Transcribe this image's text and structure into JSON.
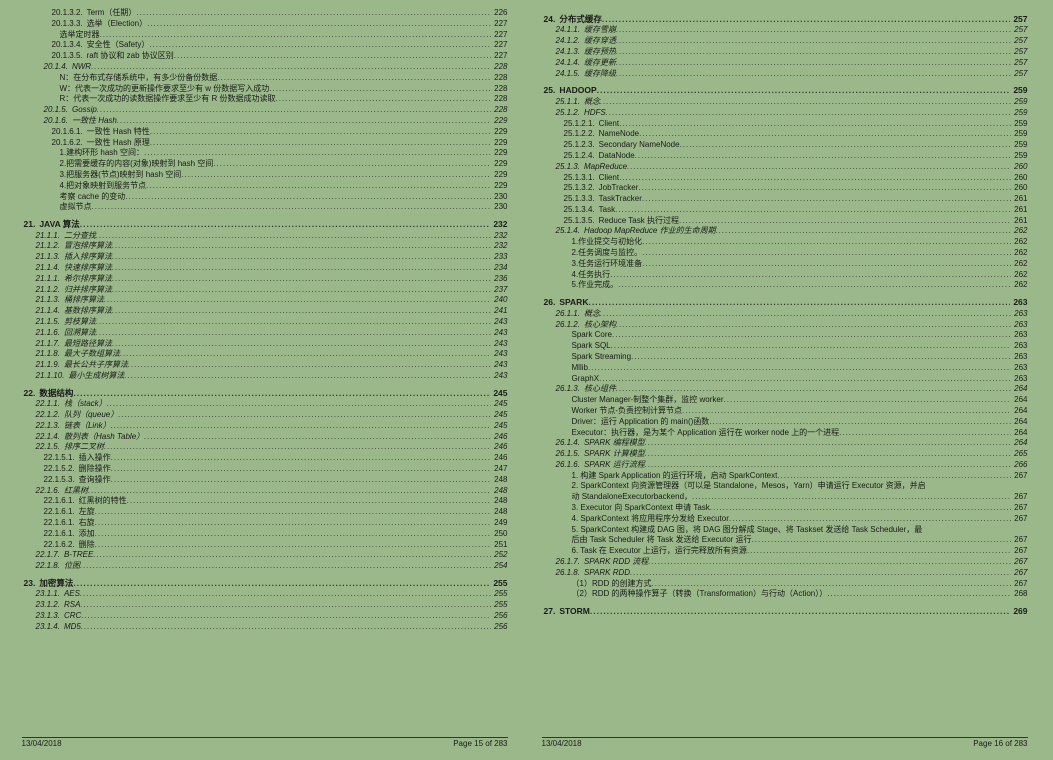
{
  "footer": {
    "date": "13/04/2018",
    "left": "Page 15 of 283",
    "right": "Page 16 of 283"
  },
  "left_page": [
    {
      "cls": "lvl4",
      "num": "20.1.3.2.",
      "title": "Term（任期）",
      "page": "226"
    },
    {
      "cls": "lvl4",
      "num": "20.1.3.3.",
      "title": "选举（Election）",
      "page": "227"
    },
    {
      "cls": "lvl5",
      "num": "",
      "title": "选举定时器",
      "page": "227"
    },
    {
      "cls": "lvl4",
      "num": "20.1.3.4.",
      "title": "安全性（Safety）",
      "page": "227"
    },
    {
      "cls": "lvl4",
      "num": "20.1.3.5.",
      "title": "raft 协议和 zab 协议区别",
      "page": "227"
    },
    {
      "cls": "lvl3i",
      "num": "20.1.4.",
      "title": "NWR",
      "page": "228"
    },
    {
      "cls": "lvl5",
      "num": "",
      "title": "N：在分布式存储系统中，有多少份备份数据",
      "page": "228"
    },
    {
      "cls": "lvl5",
      "num": "",
      "title": "W：代表一次成功的更新操作要求至少有 w 份数据写入成功",
      "page": "228"
    },
    {
      "cls": "lvl5",
      "num": "",
      "title": "R：代表一次成功的读数据操作要求至少有 R 份数据成功读取",
      "page": "228"
    },
    {
      "cls": "lvl3i",
      "num": "20.1.5.",
      "title": "Gossip",
      "page": "228"
    },
    {
      "cls": "lvl3i",
      "num": "20.1.6.",
      "title": "一致性 Hash",
      "page": "229"
    },
    {
      "cls": "lvl4",
      "num": "20.1.6.1.",
      "title": "一致性 Hash 特性",
      "page": "229"
    },
    {
      "cls": "lvl4",
      "num": "20.1.6.2.",
      "title": "一致性 Hash 原理",
      "page": "229"
    },
    {
      "cls": "lvl5",
      "num": "",
      "title": "1.建构环形 hash 空间：",
      "page": "229"
    },
    {
      "cls": "lvl5",
      "num": "",
      "title": "2.把需要缓存的内容(对象)映射到 hash 空间",
      "page": "229"
    },
    {
      "cls": "lvl5",
      "num": "",
      "title": "3.把服务器(节点)映射到 hash 空间",
      "page": "229"
    },
    {
      "cls": "lvl5",
      "num": "",
      "title": "4.把对象映射到服务节点",
      "page": "229"
    },
    {
      "cls": "lvl5",
      "num": "",
      "title": "考察 cache 的变动",
      "page": "230"
    },
    {
      "cls": "lvl5",
      "num": "",
      "title": "虚拟节点",
      "page": "230"
    },
    {
      "cls": "lvl1",
      "num": "21.",
      "title": "JAVA 算法",
      "page": "232"
    },
    {
      "cls": "lvl2i",
      "num": "21.1.1.",
      "title": "二分查找",
      "page": "232"
    },
    {
      "cls": "lvl2i",
      "num": "21.1.2.",
      "title": "冒泡排序算法",
      "page": "232"
    },
    {
      "cls": "lvl2i",
      "num": "21.1.3.",
      "title": "插入排序算法",
      "page": "233"
    },
    {
      "cls": "lvl2i",
      "num": "21.1.4.",
      "title": "快速排序算法",
      "page": "234"
    },
    {
      "cls": "lvl2i",
      "num": "21.1.1.",
      "title": "希尔排序算法",
      "page": "236"
    },
    {
      "cls": "lvl2i",
      "num": "21.1.2.",
      "title": "归并排序算法",
      "page": "237"
    },
    {
      "cls": "lvl2i",
      "num": "21.1.3.",
      "title": "桶排序算法",
      "page": "240"
    },
    {
      "cls": "lvl2i",
      "num": "21.1.4.",
      "title": "基数排序算法",
      "page": "241"
    },
    {
      "cls": "lvl2i",
      "num": "21.1.5.",
      "title": "剪枝算法",
      "page": "243"
    },
    {
      "cls": "lvl2i",
      "num": "21.1.6.",
      "title": "回溯算法",
      "page": "243"
    },
    {
      "cls": "lvl2i",
      "num": "21.1.7.",
      "title": "最短路径算法",
      "page": "243"
    },
    {
      "cls": "lvl2i",
      "num": "21.1.8.",
      "title": "最大子数组算法",
      "page": "243"
    },
    {
      "cls": "lvl2i",
      "num": "21.1.9.",
      "title": "最长公共子序算法",
      "page": "243"
    },
    {
      "cls": "lvl2i",
      "num": "21.1.10.",
      "title": "最小生成树算法",
      "page": "243"
    },
    {
      "cls": "lvl1",
      "num": "22.",
      "title": "数据结构",
      "page": "245"
    },
    {
      "cls": "lvl2i",
      "num": "22.1.1.",
      "title": "栈（stack）",
      "page": "245"
    },
    {
      "cls": "lvl2i",
      "num": "22.1.2.",
      "title": "队列（queue）",
      "page": "245"
    },
    {
      "cls": "lvl2i",
      "num": "22.1.3.",
      "title": "链表（Link）",
      "page": "245"
    },
    {
      "cls": "lvl2i",
      "num": "22.1.4.",
      "title": "散列表（Hash Table）",
      "page": "246"
    },
    {
      "cls": "lvl2i",
      "num": "22.1.5.",
      "title": "排序二叉树",
      "page": "246"
    },
    {
      "cls": "lvl3",
      "num": "22.1.5.1.",
      "title": "插入操作",
      "page": "246"
    },
    {
      "cls": "lvl3",
      "num": "22.1.5.2.",
      "title": "删除操作",
      "page": "247"
    },
    {
      "cls": "lvl3",
      "num": "22.1.5.3.",
      "title": "查询操作",
      "page": "248"
    },
    {
      "cls": "lvl2i",
      "num": "22.1.6.",
      "title": "红黑树",
      "page": "248"
    },
    {
      "cls": "lvl3",
      "num": "22.1.6.1.",
      "title": "红黑树的特性",
      "page": "248"
    },
    {
      "cls": "lvl3",
      "num": "22.1.6.1.",
      "title": "左旋",
      "page": "248"
    },
    {
      "cls": "lvl3",
      "num": "22.1.6.1.",
      "title": "右旋",
      "page": "249"
    },
    {
      "cls": "lvl3",
      "num": "22.1.6.1.",
      "title": "添加",
      "page": "250"
    },
    {
      "cls": "lvl3",
      "num": "22.1.6.2.",
      "title": "删除",
      "page": "251"
    },
    {
      "cls": "lvl2i",
      "num": "22.1.7.",
      "title": "B-TREE",
      "page": "252"
    },
    {
      "cls": "lvl2i",
      "num": "22.1.8.",
      "title": "位图",
      "page": "254"
    },
    {
      "cls": "lvl1",
      "num": "23.",
      "title": "加密算法",
      "page": "255"
    },
    {
      "cls": "lvl2i",
      "num": "23.1.1.",
      "title": "AES",
      "page": "255"
    },
    {
      "cls": "lvl2i",
      "num": "23.1.2.",
      "title": "RSA",
      "page": "255"
    },
    {
      "cls": "lvl2i",
      "num": "23.1.3.",
      "title": "CRC",
      "page": "256"
    },
    {
      "cls": "lvl2i",
      "num": "23.1.4.",
      "title": "MD5",
      "page": "256"
    }
  ],
  "right_page": [
    {
      "cls": "lvl1",
      "num": "24.",
      "title": "分布式缓存",
      "page": "257"
    },
    {
      "cls": "lvl2i",
      "num": "24.1.1.",
      "title": "缓存雪崩",
      "page": "257"
    },
    {
      "cls": "lvl2i",
      "num": "24.1.2.",
      "title": "缓存穿透",
      "page": "257"
    },
    {
      "cls": "lvl2i",
      "num": "24.1.3.",
      "title": "缓存预热",
      "page": "257"
    },
    {
      "cls": "lvl2i",
      "num": "24.1.4.",
      "title": "缓存更新",
      "page": "257"
    },
    {
      "cls": "lvl2i",
      "num": "24.1.5.",
      "title": "缓存降级",
      "page": "257"
    },
    {
      "cls": "lvl1",
      "num": "25.",
      "title": "HADOOP",
      "page": "259"
    },
    {
      "cls": "lvl2i",
      "num": "25.1.1.",
      "title": "概念",
      "page": "259"
    },
    {
      "cls": "lvl2i",
      "num": "25.1.2.",
      "title": "HDFS",
      "page": "259"
    },
    {
      "cls": "lvl3",
      "num": "25.1.2.1.",
      "title": "Client",
      "page": "259"
    },
    {
      "cls": "lvl3",
      "num": "25.1.2.2.",
      "title": "NameNode",
      "page": "259"
    },
    {
      "cls": "lvl3",
      "num": "25.1.2.3.",
      "title": "Secondary NameNode",
      "page": "259"
    },
    {
      "cls": "lvl3",
      "num": "25.1.2.4.",
      "title": "DataNode",
      "page": "259"
    },
    {
      "cls": "lvl2i",
      "num": "25.1.3.",
      "title": "MapReduce",
      "page": "260"
    },
    {
      "cls": "lvl3",
      "num": "25.1.3.1.",
      "title": "Client",
      "page": "260"
    },
    {
      "cls": "lvl3",
      "num": "25.1.3.2.",
      "title": "JobTracker",
      "page": "260"
    },
    {
      "cls": "lvl3",
      "num": "25.1.3.3.",
      "title": "TaskTracker",
      "page": "261"
    },
    {
      "cls": "lvl3",
      "num": "25.1.3.4.",
      "title": "Task",
      "page": "261"
    },
    {
      "cls": "lvl3",
      "num": "25.1.3.5.",
      "title": "Reduce Task 执行过程",
      "page": "261"
    },
    {
      "cls": "lvl2i",
      "num": "25.1.4.",
      "title": "Hadoop MapReduce 作业的生命周期",
      "page": "262"
    },
    {
      "cls": "lvl4",
      "num": "",
      "title": "1.作业提交与初始化",
      "page": "262"
    },
    {
      "cls": "lvl4",
      "num": "",
      "title": "2.任务调度与监控。",
      "page": "262"
    },
    {
      "cls": "lvl4",
      "num": "",
      "title": "3.任务运行环境准备",
      "page": "262"
    },
    {
      "cls": "lvl4",
      "num": "",
      "title": "4.任务执行",
      "page": "262"
    },
    {
      "cls": "lvl4",
      "num": "",
      "title": "5.作业完成。",
      "page": "262"
    },
    {
      "cls": "lvl1",
      "num": "26.",
      "title": "SPARK",
      "page": "263"
    },
    {
      "cls": "lvl2i",
      "num": "26.1.1.",
      "title": "概念",
      "page": "263"
    },
    {
      "cls": "lvl2i",
      "num": "26.1.2.",
      "title": "核心架构",
      "page": "263"
    },
    {
      "cls": "lvl4",
      "num": "",
      "title": "Spark Core",
      "page": "263"
    },
    {
      "cls": "lvl4",
      "num": "",
      "title": "Spark SQL",
      "page": "263"
    },
    {
      "cls": "lvl4",
      "num": "",
      "title": "Spark Streaming",
      "page": "263"
    },
    {
      "cls": "lvl4",
      "num": "",
      "title": "Mllib",
      "page": "263"
    },
    {
      "cls": "lvl4",
      "num": "",
      "title": "GraphX",
      "page": "263"
    },
    {
      "cls": "lvl2i",
      "num": "26.1.3.",
      "title": "核心组件",
      "page": "264"
    },
    {
      "cls": "lvl4",
      "num": "",
      "title": "Cluster Manager-制整个集群，监控 worker",
      "page": "264"
    },
    {
      "cls": "lvl4",
      "num": "",
      "title": "Worker 节点-负责控制计算节点",
      "page": "264"
    },
    {
      "cls": "lvl4",
      "num": "",
      "title": "Driver：运行 Application 的 main()函数",
      "page": "264"
    },
    {
      "cls": "lvl4",
      "num": "",
      "title": "Executor：执行器，是为某个 Application 运行在 worker node 上的一个进程",
      "page": "264"
    },
    {
      "cls": "lvl2i",
      "num": "26.1.4.",
      "title": "SPARK 编程模型",
      "page": "264"
    },
    {
      "cls": "lvl2i",
      "num": "26.1.5.",
      "title": "SPARK 计算模型",
      "page": "265"
    },
    {
      "cls": "lvl2i",
      "num": "26.1.6.",
      "title": "SPARK 运行流程",
      "page": "266"
    },
    {
      "cls": "lvl4",
      "num": "",
      "title": "1. 构建 Spark Application 的运行环境，启动 SparkContext",
      "page": "267"
    },
    {
      "cls": "lvl4",
      "num": "",
      "title": "2. SparkContext 向资源管理器（可以是 Standalone，Mesos，Yarn）申请运行 Executor 资源，并启",
      "page": ""
    },
    {
      "cls": "lvl4",
      "num": "",
      "title": "动 StandaloneExecutorbackend，",
      "page": "267"
    },
    {
      "cls": "lvl4",
      "num": "",
      "title": "3. Executor 向 SparkContext 申请 Task",
      "page": "267"
    },
    {
      "cls": "lvl4",
      "num": "",
      "title": "4. SparkContext 将应用程序分发给 Executor",
      "page": "267"
    },
    {
      "cls": "lvl4",
      "num": "",
      "title": "5. SparkContext 构建成 DAG 图，将 DAG 图分解成 Stage、将 Taskset 发送给 Task Scheduler，最",
      "page": ""
    },
    {
      "cls": "lvl4",
      "num": "",
      "title": "后由 Task Scheduler 将 Task 发送给 Executor 运行",
      "page": "267"
    },
    {
      "cls": "lvl4",
      "num": "",
      "title": "6. Task 在 Executor 上运行，运行完释放所有资源",
      "page": "267"
    },
    {
      "cls": "lvl2i",
      "num": "26.1.7.",
      "title": "SPARK RDD 流程",
      "page": "267"
    },
    {
      "cls": "lvl2i",
      "num": "26.1.8.",
      "title": "SPARK RDD",
      "page": "267"
    },
    {
      "cls": "lvl4",
      "num": "",
      "title": "（1）RDD 的创建方式",
      "page": "267"
    },
    {
      "cls": "lvl4",
      "num": "",
      "title": "（2）RDD 的两种操作算子（转换（Transformation）与行动（Action））",
      "page": "268"
    },
    {
      "cls": "lvl1",
      "num": "27.",
      "title": "STORM",
      "page": "269"
    }
  ]
}
